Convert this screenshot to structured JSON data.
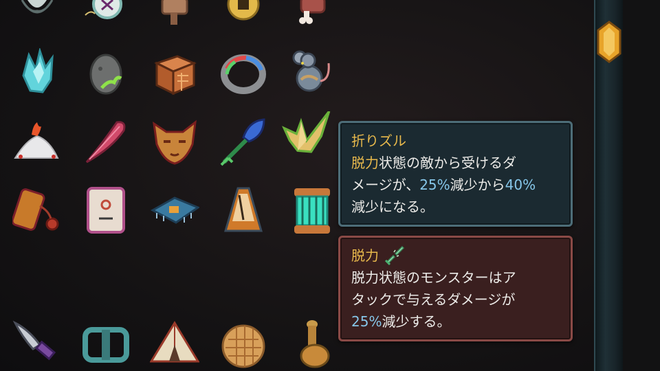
{
  "relics": [
    {
      "name": "silver-spinning-top-icon"
    },
    {
      "name": "pocket-compass-icon"
    },
    {
      "name": "wooden-mallet-icon"
    },
    {
      "name": "gold-coin-icon"
    },
    {
      "name": "meat-bone-icon"
    },
    {
      "name": "blue-crystal-icon"
    },
    {
      "name": "sprouting-egg-icon"
    },
    {
      "name": "wooden-puzzle-box-icon"
    },
    {
      "name": "rainbow-ring-icon"
    },
    {
      "name": "gray-mouse-icon"
    },
    {
      "name": "salt-pile-icon"
    },
    {
      "name": "pink-feather-icon"
    },
    {
      "name": "fox-mask-icon"
    },
    {
      "name": "blue-leaf-arrow-icon"
    },
    {
      "name": "paper-crane-icon"
    },
    {
      "name": "ornate-tag-icon"
    },
    {
      "name": "mahjong-tile-icon"
    },
    {
      "name": "circuit-board-icon"
    },
    {
      "name": "metronome-icon"
    },
    {
      "name": "glowing-cage-icon"
    },
    {
      "name": "curved-dagger-icon"
    },
    {
      "name": "teal-buckle-icon"
    },
    {
      "name": "tent-icon"
    },
    {
      "name": "waffle-icon"
    },
    {
      "name": "wax-seal-stamp-icon"
    }
  ],
  "relic_tooltip": {
    "title": "折りズル",
    "line1": {
      "kw": "脱力",
      "text": "状態の敵から受けるダ"
    },
    "line2": {
      "pre": "メージが、",
      "n1": "25%",
      "mid": "減少から",
      "n2": "40%"
    },
    "line3": "減少になる。"
  },
  "power_tooltip": {
    "title": "脱力",
    "icon": "weak-broken-sword-icon",
    "line1": "脱力状態のモンスターはア",
    "line2": "タックで与えるダメージが",
    "line3": {
      "n": "25%",
      "text": "減少する。"
    }
  },
  "colors": {
    "keyword": "#e8b94c",
    "number": "#86c6e9",
    "relic_panel": "#1b2a31",
    "power_panel": "#3a1f1f"
  }
}
